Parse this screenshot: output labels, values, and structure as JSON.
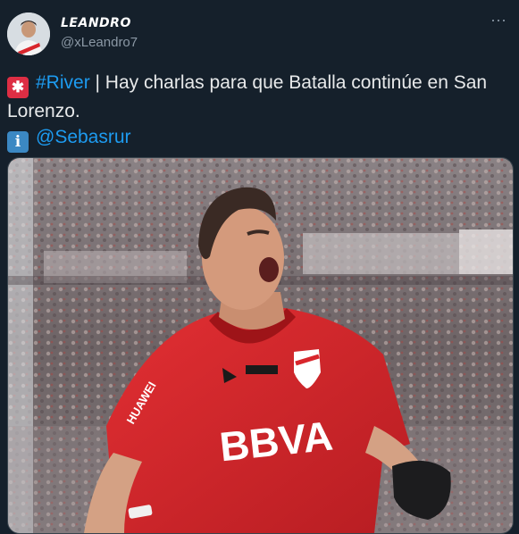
{
  "author": {
    "display_name": "LEANDRO",
    "handle": "@xLeandro7",
    "avatar_icon": "profile-photo-icon"
  },
  "more_icon": "more-options-icon",
  "more_glyph": "···",
  "tweet": {
    "line1_emoji": "police-siren-emoji",
    "hashtag": "#River",
    "text_part": " | Hay charlas para que Batalla continúe en San Lorenzo.",
    "line2_emoji": "information-emoji",
    "info_glyph": "i",
    "mention": "@Sebasrur"
  },
  "media": {
    "alt": "Goalkeeper in red River Plate jersey celebrating in a stadium",
    "jersey_sponsor": "BBVA",
    "sleeve_brand": "HUAWEI",
    "colors": {
      "jersey": "#d8262c",
      "crowd": "#7a6f70",
      "background": "#15202b"
    }
  }
}
